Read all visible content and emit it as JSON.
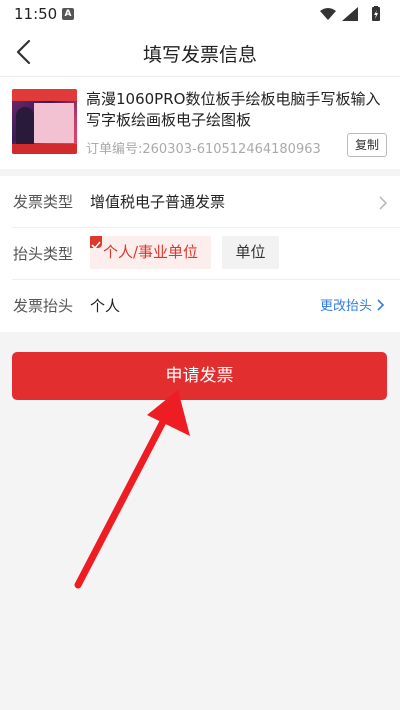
{
  "status_bar": {
    "time": "11:50",
    "app_icon_letter": "A",
    "icons": [
      "wifi-icon",
      "signal-icon",
      "battery-icon"
    ]
  },
  "nav": {
    "title": "填写发票信息",
    "back_icon": "chevron-left-icon"
  },
  "product": {
    "name": "高漫1060PRO数位板手绘板电脑手写板输入写字板绘画板电子绘图板",
    "order_number": "订单编号:260303-610512464180963",
    "copy_label": "复制"
  },
  "form": {
    "invoice_type_label": "发票类型",
    "invoice_type_value": "增值税电子普通发票",
    "header_type_label": "抬头类型",
    "header_type_options": [
      "个人/事业单位",
      "单位"
    ],
    "header_type_selected": "个人/事业单位",
    "invoice_header_label": "发票抬头",
    "invoice_header_value": "个人",
    "change_header_link": "更改抬头"
  },
  "actions": {
    "submit_label": "申请发票"
  },
  "colors": {
    "accent_red": "#e22e2e",
    "link_blue": "#2f7de1",
    "background": "#f4f4f4"
  }
}
